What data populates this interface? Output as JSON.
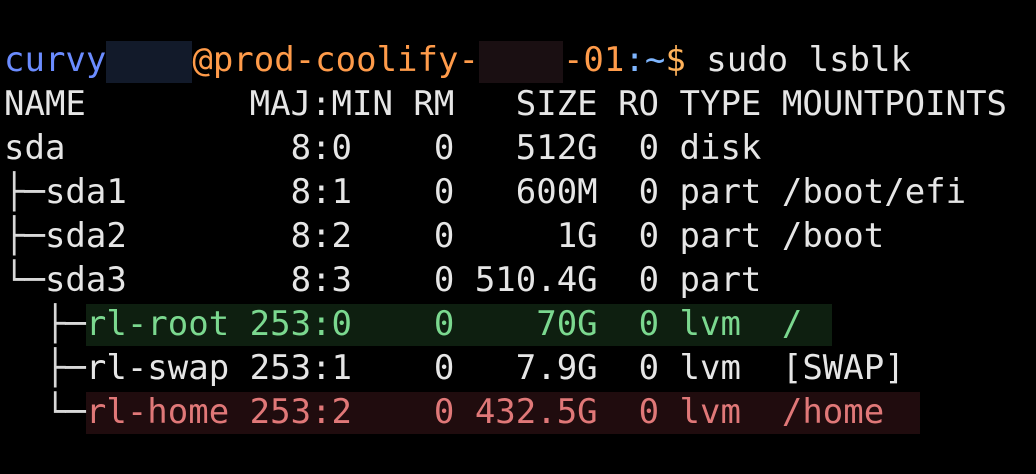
{
  "terminal": {
    "prompt": {
      "user": "curvy",
      "at_host": "@prod-coolify-",
      "host_suffix": "-01",
      "colon_path": ":~",
      "dollar": "$",
      "command": " sudo lsblk"
    },
    "header": "NAME        MAJ:MIN RM   SIZE RO TYPE MOUNTPOINTS",
    "rows": [
      {
        "tree": "",
        "name": "sda",
        "rest": "           8:0    0   512G  0 disk"
      },
      {
        "tree": "├─",
        "name": "sda1",
        "rest": "        8:1    0   600M  0 part /boot/efi"
      },
      {
        "tree": "├─",
        "name": "sda2",
        "rest": "        8:2    0     1G  0 part /boot"
      },
      {
        "tree": "└─",
        "name": "sda3",
        "rest": "        8:3    0 510.4G  0 part"
      },
      {
        "tree": "  ├─",
        "name": "rl-root",
        "rest": " 253:0    0    70G  0 lvm  /"
      },
      {
        "tree": "  ├─",
        "name": "rl-swap",
        "rest": " 253:1    0   7.9G  0 lvm  [SWAP]"
      },
      {
        "tree": "  └─",
        "name": "rl-home",
        "rest": " 253:2    0 432.5G  0 lvm  /home"
      }
    ]
  },
  "colors": {
    "background": "#000000",
    "user": "#6b8cff",
    "host": "#ff9b4a",
    "highlight_root": "#7bd88f",
    "highlight_home": "#e07878"
  }
}
